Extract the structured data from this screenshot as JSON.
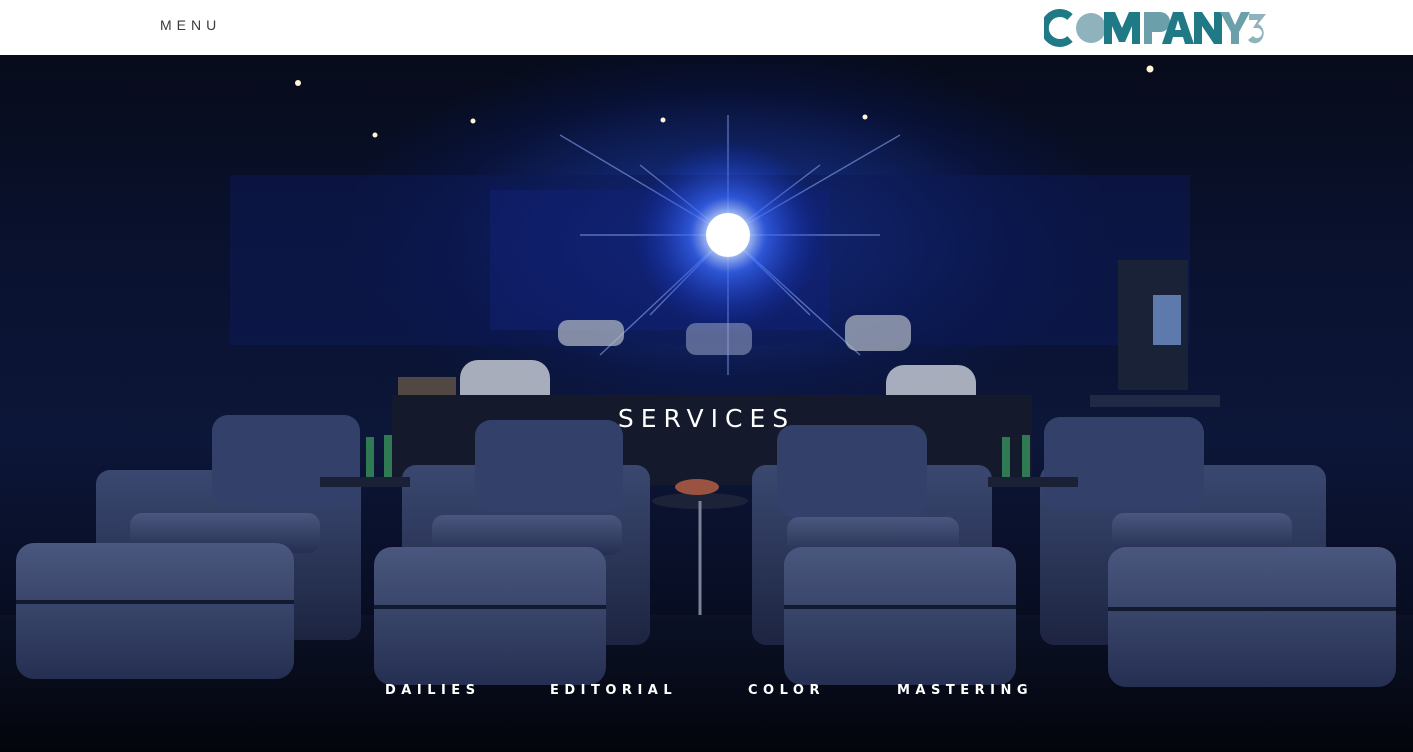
{
  "header": {
    "menu_label": "MENU",
    "logo": {
      "text": "COMPANY3",
      "colors": [
        "#1f7a85",
        "#6b9faa",
        "#8fb3bd"
      ]
    }
  },
  "hero": {
    "title": "SERVICES",
    "scene": "screening-room-photo",
    "accent_color": "#2a5cff"
  },
  "services_nav": {
    "items": [
      {
        "label": "DAILIES"
      },
      {
        "label": "EDITORIAL"
      },
      {
        "label": "COLOR"
      },
      {
        "label": "MASTERING"
      }
    ]
  }
}
